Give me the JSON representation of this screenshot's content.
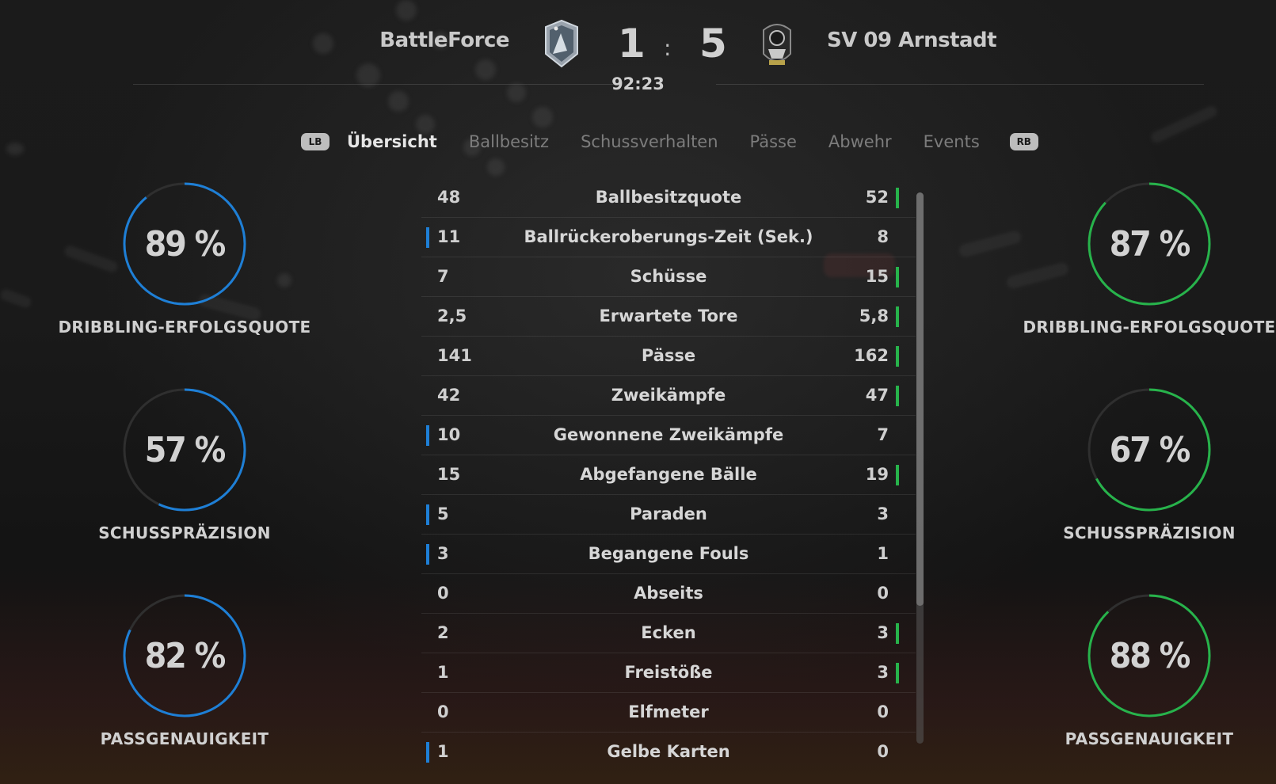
{
  "match": {
    "home_team": "BattleForce",
    "away_team": "SV 09 Arnstadt",
    "home_score": "1",
    "away_score": "5",
    "separator": ":",
    "clock": "92:23"
  },
  "tabs": {
    "lb": "LB",
    "rb": "RB",
    "items": [
      "Übersicht",
      "Ballbesitz",
      "Schussverhalten",
      "Pässe",
      "Abwehr",
      "Events"
    ],
    "active_index": 0
  },
  "colors": {
    "home_accent": "#1e7fd6",
    "away_accent": "#27b34b"
  },
  "home_rings": [
    {
      "value": "89 %",
      "label": "DRIBBLING-ERFOLGSQUOTE",
      "fraction": 0.89
    },
    {
      "value": "57 %",
      "label": "SCHUSSPRÄZISION",
      "fraction": 0.57
    },
    {
      "value": "82 %",
      "label": "PASSGENAUIGKEIT",
      "fraction": 0.82
    }
  ],
  "away_rings": [
    {
      "value": "87 %",
      "label": "DRIBBLING-ERFOLGSQUOTE",
      "fraction": 0.87
    },
    {
      "value": "67 %",
      "label": "SCHUSSPRÄZISION",
      "fraction": 0.67
    },
    {
      "value": "88 %",
      "label": "PASSGENAUIGKEIT",
      "fraction": 0.88
    }
  ],
  "stats": [
    {
      "name": "Ballbesitzquote",
      "home": "48",
      "away": "52",
      "leader": "away"
    },
    {
      "name": "Ballrückeroberungs-Zeit (Sek.)",
      "home": "11",
      "away": "8",
      "leader": "home"
    },
    {
      "name": "Schüsse",
      "home": "7",
      "away": "15",
      "leader": "away"
    },
    {
      "name": "Erwartete Tore",
      "home": "2,5",
      "away": "5,8",
      "leader": "away"
    },
    {
      "name": "Pässe",
      "home": "141",
      "away": "162",
      "leader": "away"
    },
    {
      "name": "Zweikämpfe",
      "home": "42",
      "away": "47",
      "leader": "away"
    },
    {
      "name": "Gewonnene Zweikämpfe",
      "home": "10",
      "away": "7",
      "leader": "home"
    },
    {
      "name": "Abgefangene Bälle",
      "home": "15",
      "away": "19",
      "leader": "away"
    },
    {
      "name": "Paraden",
      "home": "5",
      "away": "3",
      "leader": "home"
    },
    {
      "name": "Begangene Fouls",
      "home": "3",
      "away": "1",
      "leader": "home"
    },
    {
      "name": "Abseits",
      "home": "0",
      "away": "0",
      "leader": "none"
    },
    {
      "name": "Ecken",
      "home": "2",
      "away": "3",
      "leader": "away"
    },
    {
      "name": "Freistöße",
      "home": "1",
      "away": "3",
      "leader": "away"
    },
    {
      "name": "Elfmeter",
      "home": "0",
      "away": "0",
      "leader": "none"
    },
    {
      "name": "Gelbe Karten",
      "home": "1",
      "away": "0",
      "leader": "home"
    }
  ],
  "scroll": {
    "thumb_fraction": 0.75
  }
}
